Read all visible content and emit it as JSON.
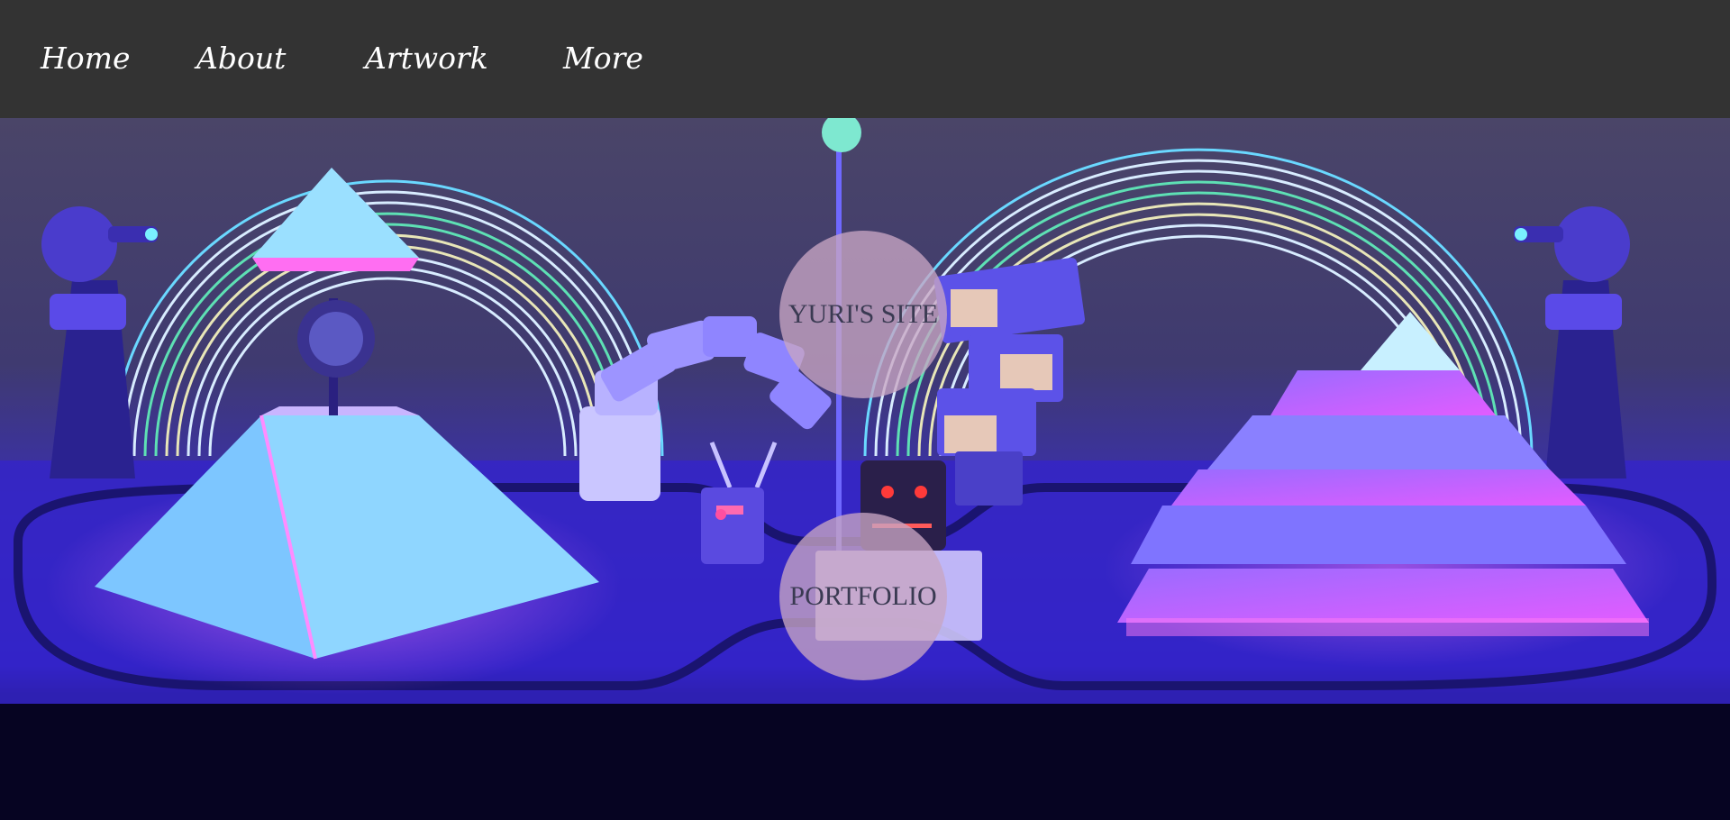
{
  "nav": {
    "items": [
      {
        "label": "Home"
      },
      {
        "label": "About"
      },
      {
        "label": "Artwork"
      },
      {
        "label": "More"
      }
    ]
  },
  "hero": {
    "image": "lit-installation-with-pyramids-rainbow-arcs-and-robotic-arms",
    "site_button_label": "YURI'S SITE",
    "portfolio_button_label": "PORTFOLIO"
  },
  "colors": {
    "navbar_bg": "#333333",
    "nav_text": "#ffffff",
    "circle_bg": "#c8a5c3",
    "circle_text": "#3a3a52"
  }
}
